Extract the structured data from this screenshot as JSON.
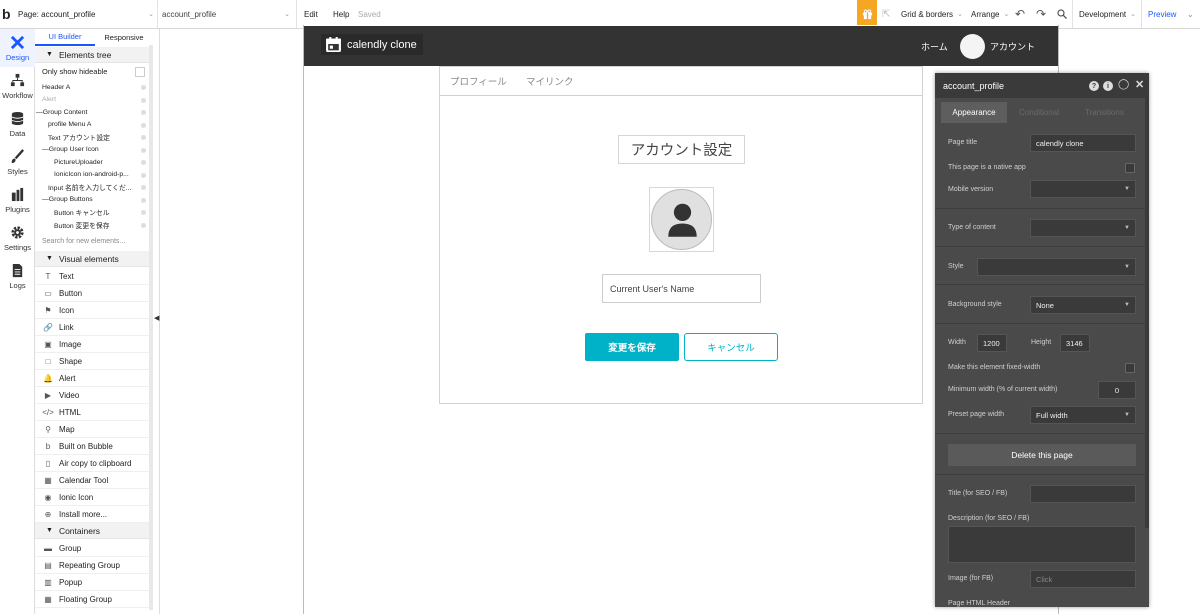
{
  "topbar": {
    "page_label": "Page: account_profile",
    "page_sub": "account_profile",
    "edit": "Edit",
    "help": "Help",
    "saved": "Saved",
    "grid_borders": "Grid & borders",
    "arrange": "Arrange",
    "development": "Development",
    "preview": "Preview"
  },
  "rail": {
    "items": [
      {
        "label": "Design"
      },
      {
        "label": "Workflow"
      },
      {
        "label": "Data"
      },
      {
        "label": "Styles"
      },
      {
        "label": "Plugins"
      },
      {
        "label": "Settings"
      },
      {
        "label": "Logs"
      }
    ]
  },
  "panel": {
    "tabs": [
      "UI Builder",
      "Responsive"
    ],
    "elements_tree": "Elements tree",
    "only_show_hideable": "Only show hideable",
    "tree": [
      {
        "label": "Header A",
        "indent": 0,
        "muted": false
      },
      {
        "label": "Alert",
        "indent": 0,
        "muted": true
      },
      {
        "label": "Group Content",
        "indent": 0,
        "muted": false,
        "prefix": "—"
      },
      {
        "label": "profile Menu A",
        "indent": 1,
        "muted": false
      },
      {
        "label": "Text アカウント設定",
        "indent": 1,
        "muted": false
      },
      {
        "label": "Group User Icon",
        "indent": 1,
        "muted": false,
        "prefix": "—"
      },
      {
        "label": "PictureUploader",
        "indent": 2,
        "muted": false
      },
      {
        "label": "IonicIcon ion-android-p...",
        "indent": 2,
        "muted": false
      },
      {
        "label": "Input 名前を入力してくだ...",
        "indent": 1,
        "muted": false
      },
      {
        "label": "Group Buttons",
        "indent": 1,
        "muted": false,
        "prefix": "—"
      },
      {
        "label": "Button キャンセル",
        "indent": 2,
        "muted": false
      },
      {
        "label": "Button 変更を保存",
        "indent": 2,
        "muted": false
      }
    ],
    "search_placeholder": "Search for new elements...",
    "visual_elements": "Visual elements",
    "visual": [
      {
        "label": "Text",
        "icon": "T"
      },
      {
        "label": "Button",
        "icon": "▭"
      },
      {
        "label": "Icon",
        "icon": "⚑"
      },
      {
        "label": "Link",
        "icon": "🔗"
      },
      {
        "label": "Image",
        "icon": "▣"
      },
      {
        "label": "Shape",
        "icon": "□"
      },
      {
        "label": "Alert",
        "icon": "🔔"
      },
      {
        "label": "Video",
        "icon": "▶"
      },
      {
        "label": "HTML",
        "icon": "</>"
      },
      {
        "label": "Map",
        "icon": "⚲"
      },
      {
        "label": "Built on Bubble",
        "icon": "b"
      },
      {
        "label": "Air copy to clipboard",
        "icon": "▯"
      },
      {
        "label": "Calendar Tool",
        "icon": "▦"
      },
      {
        "label": "Ionic Icon",
        "icon": "◉"
      },
      {
        "label": "Install more...",
        "icon": "⊕"
      }
    ],
    "containers": "Containers",
    "container_items": [
      {
        "label": "Group",
        "icon": "▬"
      },
      {
        "label": "Repeating Group",
        "icon": "▤"
      },
      {
        "label": "Popup",
        "icon": "▥"
      },
      {
        "label": "Floating Group",
        "icon": "▦"
      }
    ]
  },
  "app": {
    "brand": "calendly clone",
    "nav_home": "ホーム",
    "nav_account": "アカウント",
    "tabs": [
      "プロフィール",
      "マイリンク"
    ],
    "heading": "アカウント設定",
    "name_placeholder": "Current User's Name",
    "save_button": "変更を保存",
    "cancel_button": "キャンセル"
  },
  "properties": {
    "title": "account_profile",
    "tabs": [
      "Appearance",
      "Conditional",
      "Transitions"
    ],
    "page_title_label": "Page title",
    "page_title_value": "calendly clone",
    "native_app_label": "This page is a native app",
    "mobile_version_label": "Mobile version",
    "type_of_content_label": "Type of content",
    "style_label": "Style",
    "background_style_label": "Background style",
    "background_style_value": "None",
    "width_label": "Width",
    "width_value": "1200",
    "height_label": "Height",
    "height_value": "3146",
    "fixed_width_label": "Make this element fixed-width",
    "min_width_label": "Minimum width (% of current width)",
    "min_width_value": "0",
    "preset_label": "Preset page width",
    "preset_value": "Full width",
    "delete_button": "Delete this page",
    "seo_title_label": "Title (for SEO / FB)",
    "seo_desc_label": "Description (for SEO / FB)",
    "image_label": "Image (for FB)",
    "image_value": "Click",
    "html_header_label": "Page HTML Header"
  },
  "colors": {
    "accent_blue": "#1a56ff",
    "teal": "#00b2c8",
    "orange": "#f5a623",
    "header_dark": "#333333",
    "editor_bg": "#4a4a4a"
  }
}
